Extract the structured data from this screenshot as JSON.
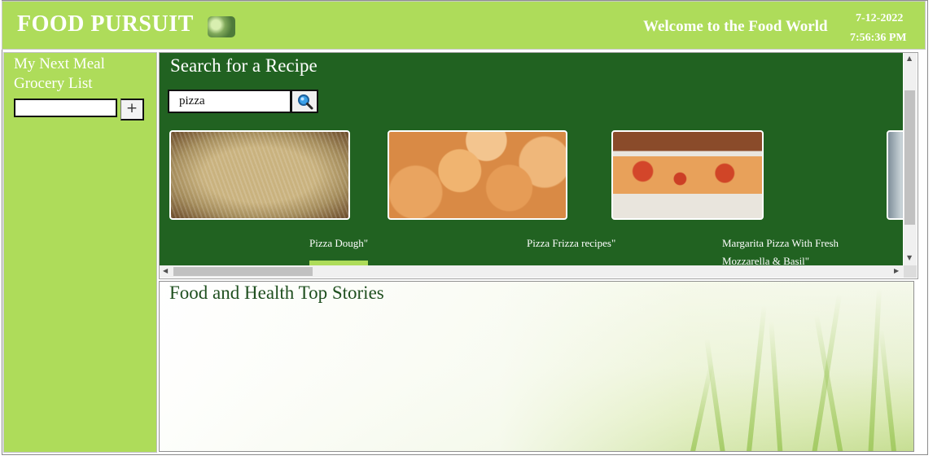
{
  "header": {
    "brand": "FOOD PURSUIT",
    "welcome": "Welcome to the Food World",
    "date": "7-12-2022",
    "time": "7:56:36 PM",
    "brand_color": "#aedc5a"
  },
  "sidebar": {
    "title_line1": "My Next Meal",
    "title_line2": "Grocery List",
    "grocery_input": {
      "value": "",
      "placeholder": ""
    },
    "add_label": "+"
  },
  "search": {
    "title": "Search for a Recipe",
    "query": "pizza",
    "button_icon": "search-icon",
    "panel_color": "#216221"
  },
  "recipes": [
    {
      "caption": "Pizza Dough\"",
      "image": "pizza-dough-image"
    },
    {
      "caption": "Pizza Frizza recipes\"",
      "image": "pizza-frizza-image"
    },
    {
      "caption": "Margarita Pizza With Fresh Mozzarella & Basil\"",
      "image": "margarita-pizza-image"
    },
    {
      "caption": "",
      "image": "partial-recipe-image"
    }
  ],
  "stories": {
    "title": "Food and Health Top Stories"
  }
}
